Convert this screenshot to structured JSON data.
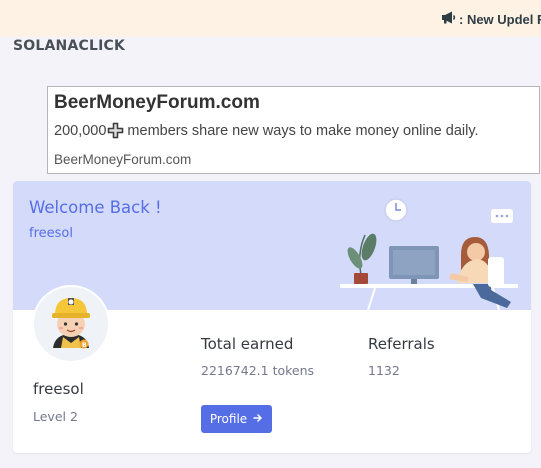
{
  "ticker": {
    "text": ": New Updel R",
    "icon": "megaphone-icon"
  },
  "brand": {
    "name": "SOLANACLICK"
  },
  "ad": {
    "title": "BeerMoneyForum.com",
    "count": "200,000",
    "description": "members share new ways to make money online daily.",
    "url": "BeerMoneyForum.com",
    "icon": "plus-icon"
  },
  "welcome": {
    "heading": "Welcome Back !",
    "username": "freesol",
    "background": "#d4daf9",
    "accent": "#556ee6"
  },
  "profile": {
    "name": "freesol",
    "level": "Level 2",
    "avatar_icon": "miner-avatar-icon",
    "button_label": "Profile",
    "button_icon": "arrow-right-icon"
  },
  "stats": {
    "earned_label": "Total earned",
    "earned_value": "2216742.1 tokens",
    "referrals_label": "Referrals",
    "referrals_value": "1132"
  }
}
